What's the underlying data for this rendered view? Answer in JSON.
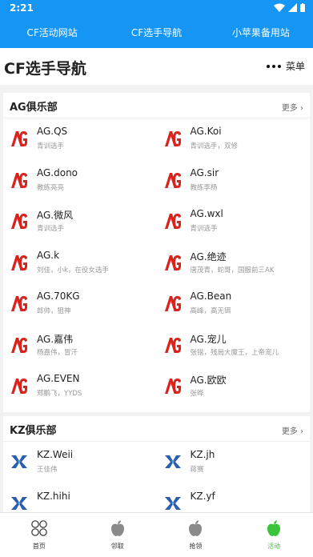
{
  "status_bar": {
    "time": "2:21"
  },
  "top_nav": {
    "tabs": [
      {
        "label": "CF活动网站"
      },
      {
        "label": "CF选手导航"
      },
      {
        "label": "小苹果备用站"
      }
    ]
  },
  "page": {
    "title": "CF选手导航",
    "menu_label": "菜单"
  },
  "sections": [
    {
      "title": "AG俱乐部",
      "more_label": "更多",
      "items": [
        {
          "name": "AG.QS",
          "desc": "青训选手"
        },
        {
          "name": "AG.Koi",
          "desc": "青训选手，双修"
        },
        {
          "name": "AG.dono",
          "desc": "教练亮亮"
        },
        {
          "name": "AG.sir",
          "desc": "教练李杨"
        },
        {
          "name": "AG.微风",
          "desc": "青训选手"
        },
        {
          "name": "AG.wxl",
          "desc": "青训选手"
        },
        {
          "name": "AG.k",
          "desc": "刘佳，小k，在役女选手"
        },
        {
          "name": "AG.绝迹",
          "desc": "唐茂青，蛇哥，国服前三AK"
        },
        {
          "name": "AG.70KG",
          "desc": "郎帅，狙神"
        },
        {
          "name": "AG.Bean",
          "desc": "高峰，高无铒"
        },
        {
          "name": "AG.嘉伟",
          "desc": "杨嘉伟，冒汗"
        },
        {
          "name": "AG.宠儿",
          "desc": "张锴，残局大魔王，上帝宠儿"
        },
        {
          "name": "AG.EVEN",
          "desc": "郑鹏飞，YYDS"
        },
        {
          "name": "AG.欧欧",
          "desc": "张晔"
        }
      ]
    },
    {
      "title": "KZ俱乐部",
      "more_label": "更多",
      "items": [
        {
          "name": "KZ.Weii",
          "desc": "王佳伟"
        },
        {
          "name": "KZ.jh",
          "desc": "蒋赛"
        },
        {
          "name": "KZ.hihi",
          "desc": ""
        },
        {
          "name": "KZ.yf",
          "desc": ""
        }
      ]
    }
  ],
  "bottom_nav": {
    "items": [
      {
        "label": "首页",
        "icon": "grid-circles-icon",
        "active": false
      },
      {
        "label": "邻取",
        "icon": "apple-icon",
        "active": false
      },
      {
        "label": "抢领",
        "icon": "apple-icon",
        "active": false
      },
      {
        "label": "活动",
        "icon": "apple-icon",
        "active": true
      }
    ]
  },
  "colors": {
    "primary": "#1596f5",
    "ag_red": "#d9231c",
    "kz_blue": "#2a5fb0",
    "active_green": "#3bc43b"
  }
}
